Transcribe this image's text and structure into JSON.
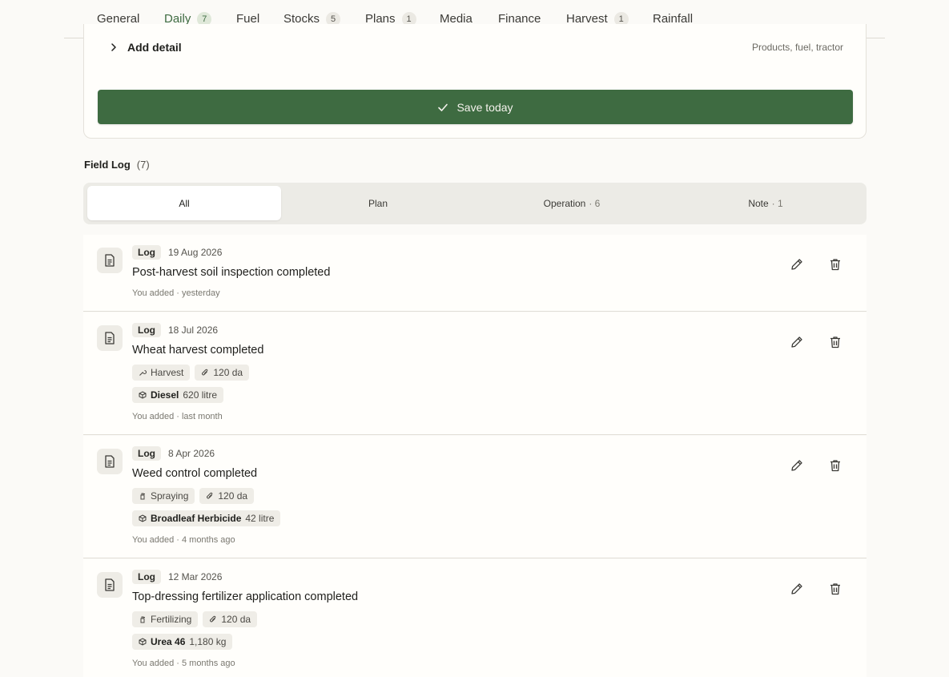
{
  "tabs": [
    {
      "label": "General",
      "count": null
    },
    {
      "label": "Daily",
      "count": "7",
      "active": true
    },
    {
      "label": "Fuel",
      "count": null
    },
    {
      "label": "Stocks",
      "count": "5"
    },
    {
      "label": "Plans",
      "count": "1"
    },
    {
      "label": "Media",
      "count": null
    },
    {
      "label": "Finance",
      "count": null
    },
    {
      "label": "Harvest",
      "count": "1"
    },
    {
      "label": "Rainfall",
      "count": null
    }
  ],
  "form": {
    "add_detail_label": "Add detail",
    "add_detail_hint": "Products, fuel, tractor",
    "save_label": "Save today"
  },
  "field_log": {
    "title": "Field Log",
    "count": "(7)",
    "filters": [
      {
        "label": "All",
        "count": ""
      },
      {
        "label": "Plan",
        "count": ""
      },
      {
        "label": "Operation",
        "count": "· 6"
      },
      {
        "label": "Note",
        "count": "· 1"
      }
    ],
    "entries": [
      {
        "badge": "Log",
        "date": "19 Aug 2026",
        "title": "Post-harvest soil inspection completed",
        "added": "You added · yesterday"
      },
      {
        "badge": "Log",
        "date": "18 Jul 2026",
        "title": "Wheat harvest completed",
        "operation": "Harvest",
        "area": "120 da",
        "product_name": "Diesel",
        "product_qty": "620 litre",
        "added": "You added · last month"
      },
      {
        "badge": "Log",
        "date": "8 Apr 2026",
        "title": "Weed control completed",
        "operation": "Spraying",
        "area": "120 da",
        "product_name": "Broadleaf Herbicide",
        "product_qty": "42 litre",
        "added": "You added · 4 months ago"
      },
      {
        "badge": "Log",
        "date": "12 Mar 2026",
        "title": "Top-dressing fertilizer application completed",
        "operation": "Fertilizing",
        "area": "120 da",
        "product_name": "Urea 46",
        "product_qty": "1,180 kg",
        "added": "You added · 5 months ago"
      }
    ]
  },
  "colors": {
    "accent": "#3e6b41",
    "background": "#fbfaf7",
    "chip": "#efede7"
  },
  "icons": [
    "chevron-right-icon",
    "check-icon",
    "document-icon",
    "pencil-icon",
    "trash-icon",
    "wrench-icon",
    "paperclip-icon",
    "package-icon",
    "spray-bottle-icon"
  ]
}
